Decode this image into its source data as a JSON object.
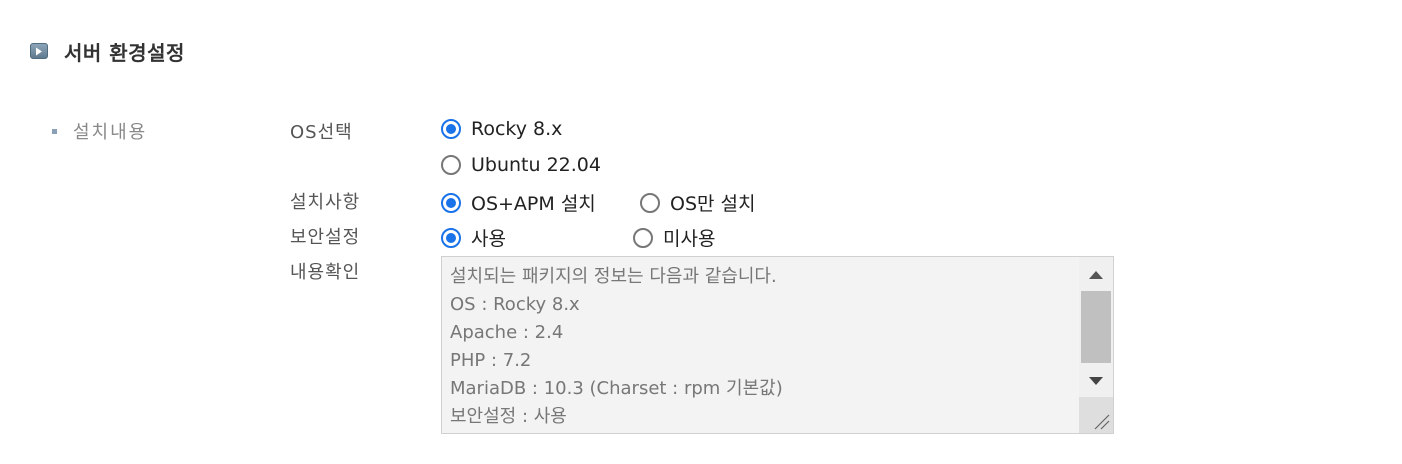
{
  "section": {
    "title": "서버 환경설정",
    "icon": "play-icon"
  },
  "left_label": "설치내용",
  "os": {
    "label": "OS선택",
    "options": [
      {
        "label": "Rocky 8.x",
        "checked": true
      },
      {
        "label": "Ubuntu 22.04",
        "checked": false
      }
    ]
  },
  "install": {
    "label": "설치사항",
    "options": [
      {
        "label": "OS+APM 설치",
        "checked": true
      },
      {
        "label": "OS만 설치",
        "checked": false
      }
    ]
  },
  "security": {
    "label": "보안설정",
    "options": [
      {
        "label": "사용",
        "checked": true
      },
      {
        "label": "미사용",
        "checked": false
      }
    ]
  },
  "confirm": {
    "label": "내용확인",
    "text": "설치되는 패키지의 정보는 다음과 같습니다.\nOS : Rocky 8.x\nApache : 2.4\nPHP : 7.2\nMariaDB : 10.3 (Charset : rpm 기본값)\n보안설정 : 사용"
  },
  "colors": {
    "accent": "#1a73e8",
    "icon": "#5f7a90"
  }
}
